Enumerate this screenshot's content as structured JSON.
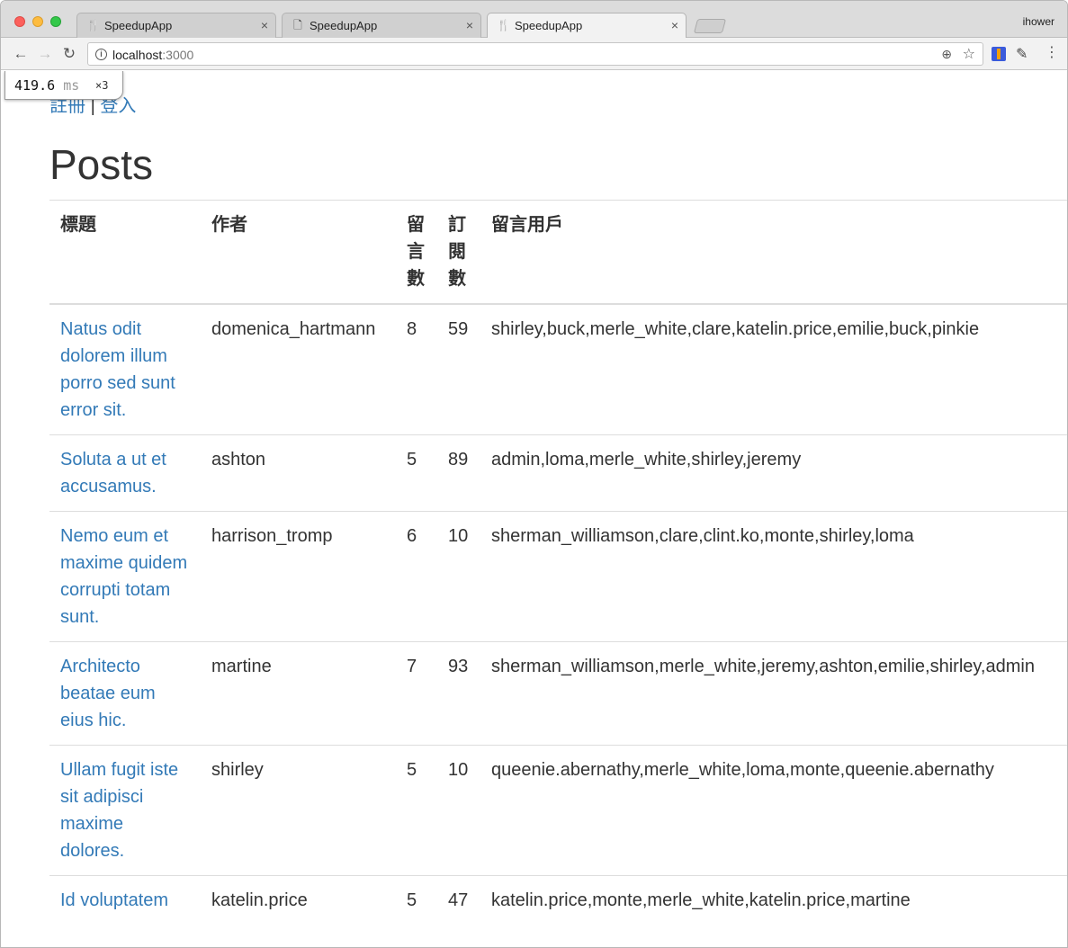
{
  "browser": {
    "tabs": [
      {
        "title": "SpeedupApp",
        "icon": "fork-knife-icon",
        "active": false
      },
      {
        "title": "SpeedupApp",
        "icon": "document-icon",
        "active": false
      },
      {
        "title": "SpeedupApp",
        "icon": "fork-knife-icon",
        "active": true
      }
    ],
    "profile_name": "ihower",
    "url_host": "localhost",
    "url_port": ":3000"
  },
  "perf": {
    "time": "419.6",
    "unit": "ms",
    "count": "×3"
  },
  "auth": {
    "register": "註冊",
    "separator": "|",
    "login": "登入"
  },
  "page": {
    "title": "Posts"
  },
  "table": {
    "headers": {
      "title": "標題",
      "author": "作者",
      "comments_count": "留言數",
      "subscriptions_count": "訂閱數",
      "commenters": "留言用戶"
    },
    "rows": [
      {
        "title": "Natus odit dolorem illum porro sed sunt error sit.",
        "author": "domenica_hartmann",
        "comments": "8",
        "subscriptions": "59",
        "commenters": "shirley,buck,merle_white,clare,katelin.price,emilie,buck,pinkie"
      },
      {
        "title": "Soluta a ut et accusamus.",
        "author": "ashton",
        "comments": "5",
        "subscriptions": "89",
        "commenters": "admin,loma,merle_white,shirley,jeremy"
      },
      {
        "title": "Nemo eum et maxime quidem corrupti totam sunt.",
        "author": "harrison_tromp",
        "comments": "6",
        "subscriptions": "10",
        "commenters": "sherman_williamson,clare,clint.ko,monte,shirley,loma"
      },
      {
        "title": "Architecto beatae eum eius hic.",
        "author": "martine",
        "comments": "7",
        "subscriptions": "93",
        "commenters": "sherman_williamson,merle_white,jeremy,ashton,emilie,shirley,admin"
      },
      {
        "title": "Ullam fugit iste sit adipisci maxime dolores.",
        "author": "shirley",
        "comments": "5",
        "subscriptions": "10",
        "commenters": "queenie.abernathy,merle_white,loma,monte,queenie.abernathy"
      },
      {
        "title": "Id voluptatem",
        "author": "katelin.price",
        "comments": "5",
        "subscriptions": "47",
        "commenters": "katelin.price,monte,merle_white,katelin.price,martine"
      }
    ]
  }
}
